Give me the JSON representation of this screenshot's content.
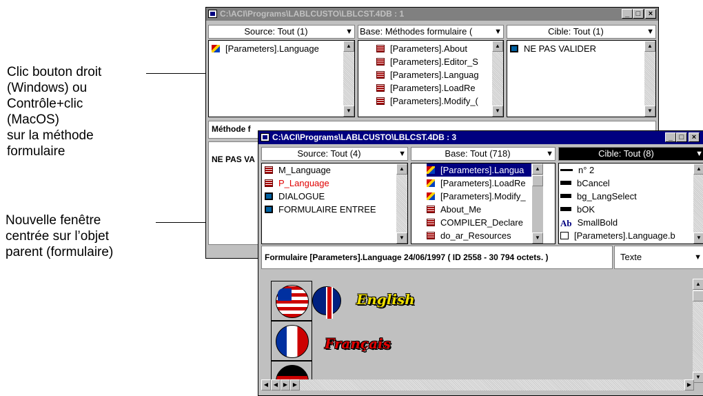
{
  "annotations": {
    "callout1": [
      "Clic bouton droit",
      "(Windows) ou",
      "Contrôle+clic",
      "(MacOS)",
      "sur la méthode",
      "formulaire"
    ],
    "callout2": [
      "Nouvelle fenêtre",
      "centrée sur l’objet",
      "parent (formulaire)"
    ]
  },
  "back_window": {
    "title": "C:\\ACI\\Programs\\LABLCUSTO\\LBLCST.4DB : 1",
    "source_header": "Source: Tout (1)",
    "base_header": "Base: Méthodes formulaire (",
    "cible_header": "Cible: Tout (1)",
    "source_items": [
      {
        "icon": "parameters-icon",
        "label": "[Parameters].Language"
      }
    ],
    "base_items": [
      {
        "icon": "form-method-icon",
        "label": "[Parameters].About"
      },
      {
        "icon": "form-method-icon",
        "label": "[Parameters].Editor_S"
      },
      {
        "icon": "form-method-icon",
        "label": "[Parameters].Languag"
      },
      {
        "icon": "form-method-icon",
        "label": "[Parameters].LoadRe"
      },
      {
        "icon": "form-method-icon",
        "label": "[Parameters].Modify_("
      }
    ],
    "cible_items": [
      {
        "icon": "form-icon",
        "label": "NE PAS VALIDER"
      }
    ],
    "status_partial": "Méthode f",
    "status_partial2": "NE PAS VA"
  },
  "front_window": {
    "title": "C:\\ACI\\Programs\\LABLCUSTO\\LBLCST.4DB : 3",
    "source_header": "Source: Tout (4)",
    "base_header": "Base: Tout (718)",
    "cible_header": "Cible: Tout (8)",
    "source_items": [
      {
        "icon": "method-icon",
        "label": "M_Language",
        "highlight": false
      },
      {
        "icon": "method-icon",
        "label": "P_Language",
        "highlight": true
      },
      {
        "icon": "form-icon",
        "label": "DIALOGUE",
        "highlight": false
      },
      {
        "icon": "form-icon",
        "label": "FORMULAIRE ENTREE",
        "highlight": false
      }
    ],
    "base_items": [
      {
        "icon": "parameters-icon",
        "label": "[Parameters].Langua",
        "selected": true
      },
      {
        "icon": "parameters-icon",
        "label": "[Parameters].LoadRe",
        "selected": false
      },
      {
        "icon": "parameters-icon",
        "label": "[Parameters].Modify_",
        "selected": false
      },
      {
        "icon": "method-icon",
        "label": "About_Me",
        "selected": false
      },
      {
        "icon": "method-icon",
        "label": "COMPILER_Declare",
        "selected": false
      },
      {
        "icon": "method-icon",
        "label": "do_ar_Resources",
        "selected": false
      }
    ],
    "cible_items": [
      {
        "icon": "line-icon",
        "label": "n° 2"
      },
      {
        "icon": "button-icon",
        "label": "bCancel"
      },
      {
        "icon": "button-icon",
        "label": "bg_LangSelect"
      },
      {
        "icon": "button-icon",
        "label": "bOK"
      },
      {
        "icon": "font-ab-icon",
        "label": "SmallBold"
      },
      {
        "icon": "document-icon",
        "label": "[Parameters].Language.b"
      }
    ],
    "status": "Formulaire [Parameters].Language  24/06/1997 ( ID 2558 - 30 794 octets. )",
    "view_mode": "Texte",
    "preview_languages": [
      "English",
      "Français"
    ]
  },
  "window_buttons": {
    "minimize": "_",
    "maximize": "□",
    "close": "×"
  },
  "scroll_glyphs": {
    "up": "▲",
    "down": "▼",
    "left": "◀",
    "right": "▶",
    "dropdown": "▼"
  }
}
